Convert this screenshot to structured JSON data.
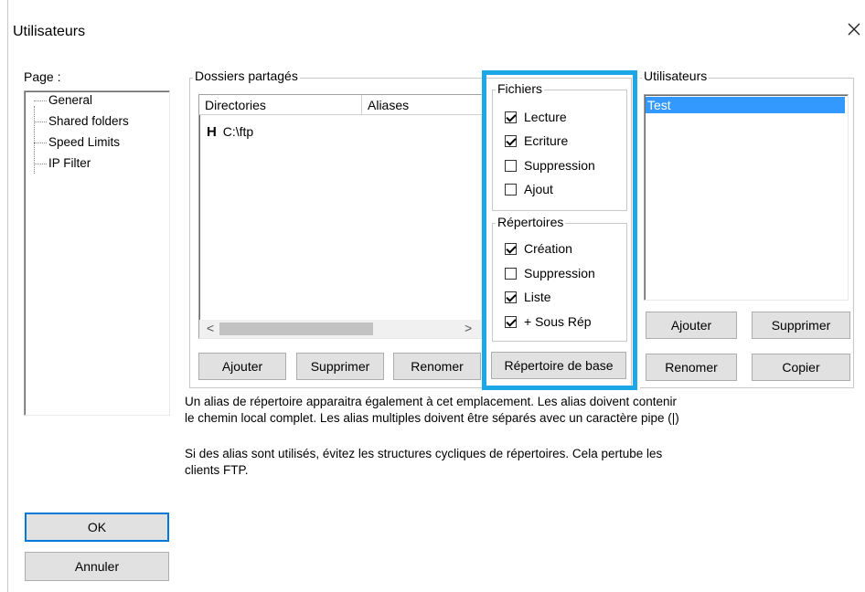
{
  "window": {
    "title": "Utilisateurs",
    "close_glyph": "✕"
  },
  "page_panel": {
    "label": "Page :",
    "items": [
      "General",
      "Shared folders",
      "Speed Limits",
      "IP Filter"
    ]
  },
  "shared_folders": {
    "title": "Dossiers partagés",
    "columns": [
      "Directories",
      "Aliases"
    ],
    "rows": [
      {
        "flag": "H",
        "path": "C:\\ftp"
      }
    ],
    "buttons": {
      "add": "Ajouter",
      "remove": "Supprimer",
      "rename": "Renomer"
    },
    "scroll_left": "<",
    "scroll_right": ">"
  },
  "permissions": {
    "files_title": "Fichiers",
    "files": [
      {
        "label": "Lecture",
        "checked": true
      },
      {
        "label": "Ecriture",
        "checked": true
      },
      {
        "label": "Suppression",
        "checked": false
      },
      {
        "label": "Ajout",
        "checked": false
      }
    ],
    "dirs_title": "Répertoires",
    "dirs": [
      {
        "label": "Création",
        "checked": true
      },
      {
        "label": "Suppression",
        "checked": false
      },
      {
        "label": "Liste",
        "checked": true
      },
      {
        "label": "+ Sous Rép",
        "checked": true
      }
    ],
    "home_dir_button": "Répertoire de base"
  },
  "users": {
    "title": "Utilisateurs",
    "list": [
      "Test"
    ],
    "buttons": {
      "add": "Ajouter",
      "remove": "Supprimer",
      "rename": "Renomer",
      "copy": "Copier"
    }
  },
  "help": {
    "paragraph1_line1": "Un alias de répertoire apparaitra également à cet emplacement. Les alias doivent contenir",
    "paragraph1_line2": "le chemin local complet. Les alias multiples doivent être séparés avec un caractère pipe (|)",
    "paragraph2_line1": "Si des alias sont utilisés, évitez les structures cycliques de répertoires. Cela pertube les",
    "paragraph2_line2": "clients FTP."
  },
  "dialog_buttons": {
    "ok": "OK",
    "cancel": "Annuler"
  },
  "colors": {
    "highlight": "#1ea7e6",
    "selection": "#3399ff",
    "ok_border": "#0078d7"
  }
}
